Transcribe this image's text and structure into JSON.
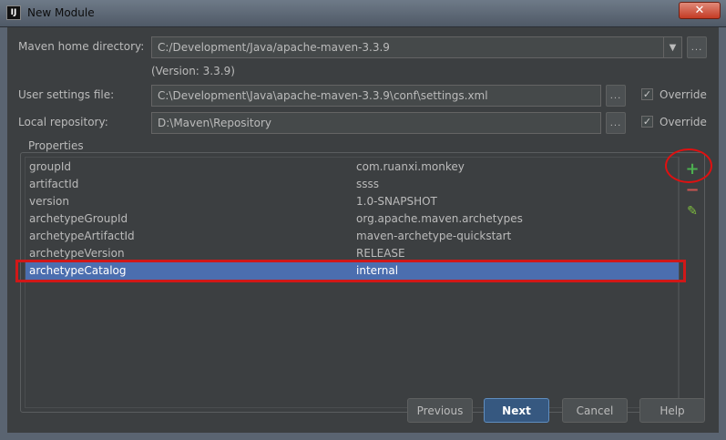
{
  "window": {
    "title": "New Module",
    "app_icon": "IJ",
    "close_glyph": "✕"
  },
  "form": {
    "maven_home": {
      "label": "Maven home directory:",
      "value": "C:/Development/Java/apache-maven-3.3.9",
      "version_note": "(Version: 3.3.9)"
    },
    "user_settings": {
      "label": "User settings file:",
      "value": "C:\\Development\\Java\\apache-maven-3.3.9\\conf\\settings.xml",
      "override_label": "Override",
      "override_checked": true
    },
    "local_repo": {
      "label": "Local repository:",
      "value": "D:\\Maven\\Repository",
      "override_label": "Override",
      "override_checked": true
    },
    "browse_label": "..."
  },
  "properties": {
    "title": "Properties",
    "rows": [
      {
        "key": "groupId",
        "value": "com.ruanxi.monkey"
      },
      {
        "key": "artifactId",
        "value": "ssss"
      },
      {
        "key": "version",
        "value": "1.0-SNAPSHOT"
      },
      {
        "key": "archetypeGroupId",
        "value": "org.apache.maven.archetypes"
      },
      {
        "key": "archetypeArtifactId",
        "value": "maven-archetype-quickstart"
      },
      {
        "key": "archetypeVersion",
        "value": "RELEASE"
      },
      {
        "key": "archetypeCatalog",
        "value": "internal"
      }
    ],
    "selected_index": 6,
    "tools": {
      "add": "+",
      "remove": "−",
      "edit": "✎"
    }
  },
  "colors": {
    "accent": "#4b6eaf",
    "add_green": "#4caf50",
    "remove_red": "#c75450",
    "annotation_red": "#e01010"
  },
  "buttons": {
    "previous": "Previous",
    "next": "Next",
    "cancel": "Cancel",
    "help": "Help"
  }
}
